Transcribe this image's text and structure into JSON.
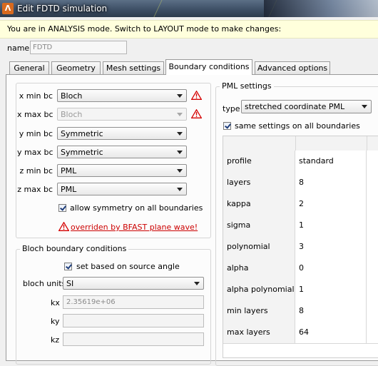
{
  "window": {
    "title": "Edit FDTD simulation",
    "icon": "lumerical-icon"
  },
  "banner": {
    "text": "You are in ANALYSIS mode.  Switch to LAYOUT mode to make changes:"
  },
  "name_field": {
    "label": "name",
    "value": "FDTD"
  },
  "tabs": [
    {
      "label": "General",
      "active": false
    },
    {
      "label": "Geometry",
      "active": false
    },
    {
      "label": "Mesh settings",
      "active": false
    },
    {
      "label": "Boundary conditions",
      "active": true
    },
    {
      "label": "Advanced options",
      "active": false
    }
  ],
  "boundary_group": {
    "rows": [
      {
        "label": "x min bc",
        "value": "Bloch",
        "enabled": true,
        "warning": true
      },
      {
        "label": "x max bc",
        "value": "Bloch",
        "enabled": false,
        "warning": true
      },
      {
        "label": "y min bc",
        "value": "Symmetric",
        "enabled": true,
        "warning": false
      },
      {
        "label": "y max bc",
        "value": "Symmetric",
        "enabled": true,
        "warning": false
      },
      {
        "label": "z min bc",
        "value": "PML",
        "enabled": true,
        "warning": false
      },
      {
        "label": "z max bc",
        "value": "PML",
        "enabled": true,
        "warning": false
      }
    ],
    "allow_symmetry": {
      "label": "allow symmetry on all boundaries",
      "checked": true
    },
    "override_warning": "overriden by BFAST plane wave!",
    "warning_color": "#cc0000"
  },
  "bloch_group": {
    "title": "Bloch boundary conditions",
    "source_angle": {
      "label": "set based on source angle",
      "checked": true
    },
    "units": {
      "label": "bloch units",
      "value": "SI"
    },
    "kx": {
      "label": "kx",
      "value": "2.35619e+06"
    },
    "ky": {
      "label": "ky",
      "value": ""
    },
    "kz": {
      "label": "kz",
      "value": ""
    }
  },
  "pml_group": {
    "title": "PML settings",
    "type": {
      "label": "type",
      "value": "stretched coordinate PML"
    },
    "same_settings": {
      "label": "same settings on all boundaries",
      "checked": true
    },
    "table": [
      {
        "key": "profile",
        "value": "standard"
      },
      {
        "key": "layers",
        "value": "8"
      },
      {
        "key": "kappa",
        "value": "2"
      },
      {
        "key": "sigma",
        "value": "1"
      },
      {
        "key": "polynomial",
        "value": "3"
      },
      {
        "key": "alpha",
        "value": "0"
      },
      {
        "key": "alpha polynomial",
        "value": "1"
      },
      {
        "key": "min layers",
        "value": "8"
      },
      {
        "key": "max layers",
        "value": "64"
      }
    ]
  }
}
